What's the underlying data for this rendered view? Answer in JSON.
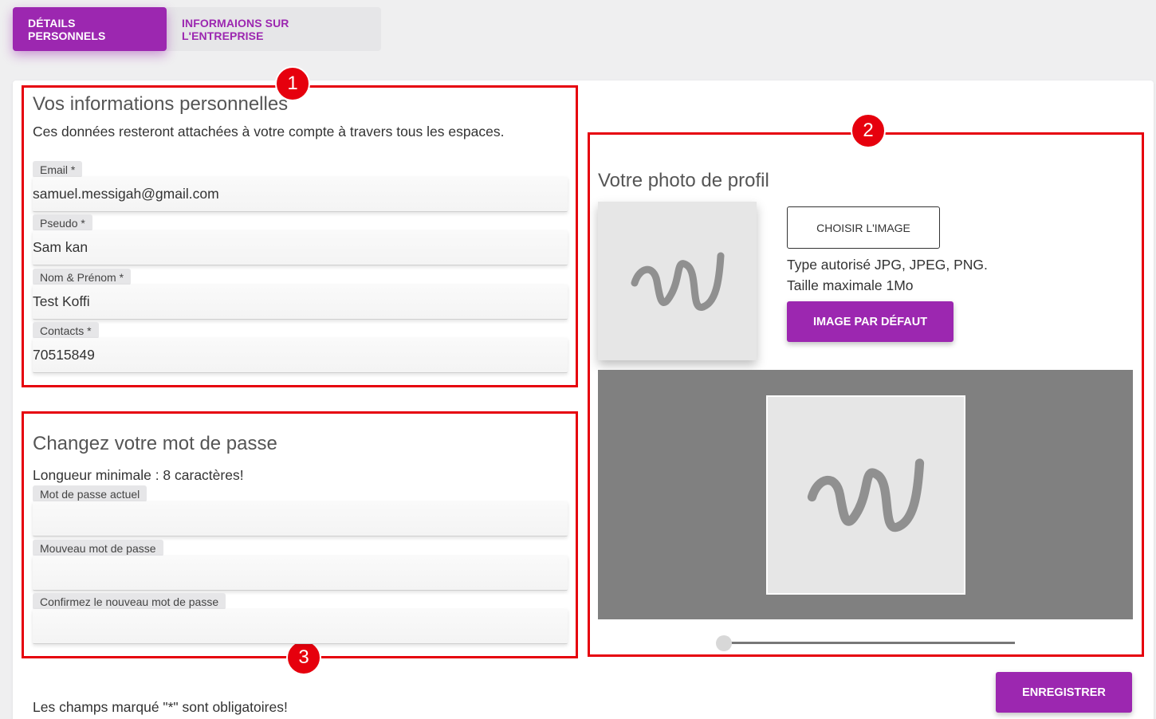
{
  "tabs": [
    {
      "label": "DÉTAILS PERSONNELS"
    },
    {
      "label": "INFORMAIONS SUR L'ENTREPRISE"
    }
  ],
  "badges": [
    "1",
    "2",
    "3"
  ],
  "personal": {
    "title": "Vos informations personnelles",
    "subtitle": "Ces données resteront attachées à votre compte à travers tous les espaces.",
    "fields": [
      {
        "label": "Email *",
        "value": "samuel.messigah@gmail.com"
      },
      {
        "label": "Pseudo *",
        "value": "Sam kan"
      },
      {
        "label": "Nom & Prénom *",
        "value": "Test Koffi"
      },
      {
        "label": "Contacts *",
        "value": "70515849"
      }
    ]
  },
  "password": {
    "title": "Changez votre mot de passe",
    "subtitle": "Longueur minimale : 8 caractères!",
    "fields": [
      {
        "label": "Mot de passe actuel",
        "value": ""
      },
      {
        "label": "Mouveau mot de passe",
        "value": ""
      },
      {
        "label": "Confirmez le nouveau mot de passe",
        "value": ""
      }
    ]
  },
  "photo": {
    "title": "Votre photo de profil",
    "choose_label": "CHOISIR L'IMAGE",
    "allowed_types": "Type autorisé JPG, JPEG, PNG.",
    "max_size": "Taille maximale 1Mo",
    "default_label": "IMAGE PAR DÉFAUT",
    "zoom_level": 0
  },
  "footer": {
    "required_note": "Les champs marqué \"*\" sont obligatoires!",
    "save_label": "ENREGISTRER"
  },
  "colors": {
    "accent": "#9c27b0",
    "highlight": "#e6000d"
  },
  "icons": {
    "placeholder": "squiggle-placeholder-icon"
  }
}
